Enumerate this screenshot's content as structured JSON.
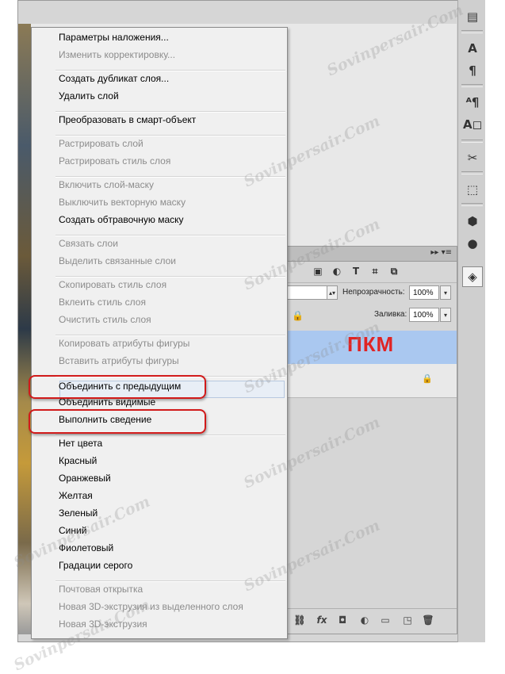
{
  "context_menu": {
    "items": [
      {
        "label": "Параметры наложения...",
        "enabled": true
      },
      {
        "label": "Изменить корректировку...",
        "enabled": false
      },
      {
        "label": "Создать дубликат слоя...",
        "enabled": true
      },
      {
        "label": "Удалить слой",
        "enabled": true
      },
      {
        "label": "Преобразовать в смарт-объект",
        "enabled": true
      },
      {
        "label": "Растрировать слой",
        "enabled": false
      },
      {
        "label": "Растрировать стиль слоя",
        "enabled": false
      },
      {
        "label": "Включить слой-маску",
        "enabled": false
      },
      {
        "label": "Выключить векторную маску",
        "enabled": false
      },
      {
        "label": "Создать обтравочную маску",
        "enabled": true
      },
      {
        "label": "Связать слои",
        "enabled": false
      },
      {
        "label": "Выделить связанные слои",
        "enabled": false
      },
      {
        "label": "Скопировать стиль слоя",
        "enabled": false
      },
      {
        "label": "Вклеить стиль слоя",
        "enabled": false
      },
      {
        "label": "Очистить стиль слоя",
        "enabled": false
      },
      {
        "label": "Копировать атрибуты фигуры",
        "enabled": false
      },
      {
        "label": "Вставить атрибуты фигуры",
        "enabled": false
      },
      {
        "label": "Объединить с предыдущим",
        "enabled": true,
        "highlighted": true
      },
      {
        "label": "Объединить видимые",
        "enabled": true
      },
      {
        "label": "Выполнить сведение",
        "enabled": true,
        "highlighted": true
      },
      {
        "label": "Нет цвета",
        "enabled": true
      },
      {
        "label": "Красный",
        "enabled": true
      },
      {
        "label": "Оранжевый",
        "enabled": true
      },
      {
        "label": "Желтая",
        "enabled": true
      },
      {
        "label": "Зеленый",
        "enabled": true
      },
      {
        "label": "Синий",
        "enabled": true
      },
      {
        "label": "Фиолетовый",
        "enabled": true
      },
      {
        "label": "Градации серого",
        "enabled": true
      },
      {
        "label": "Почтовая открытка",
        "enabled": false
      },
      {
        "label": "Новая 3D-экструзия из выделенного слоя",
        "enabled": false
      },
      {
        "label": "Новая 3D-экструзия",
        "enabled": false
      }
    ]
  },
  "layers_panel": {
    "opacity_label": "Непрозрачность:",
    "opacity_value": "100%",
    "fill_label": "Заливка:",
    "fill_value": "100%"
  },
  "annotation": {
    "text": "ПКМ",
    "color": "#e02424"
  },
  "watermark": {
    "text": "Sovinpersair.Com"
  },
  "icons": {
    "toolbar": [
      "history-icon",
      "character-icon",
      "paragraph-icon",
      "character-styles-icon",
      "paragraph-styles-icon",
      "tools-icon",
      "3d-icon",
      "3d-object-icon",
      "materials-icon",
      "layers-icon"
    ],
    "layers_filter": [
      "image-filter-icon",
      "adjustment-filter-icon",
      "type-filter-icon",
      "shape-filter-icon",
      "smart-object-filter-icon"
    ],
    "layers_bottom": [
      "link-icon",
      "fx-icon",
      "mask-icon",
      "adjustment-icon",
      "folder-icon",
      "new-layer-icon",
      "trash-icon"
    ]
  }
}
